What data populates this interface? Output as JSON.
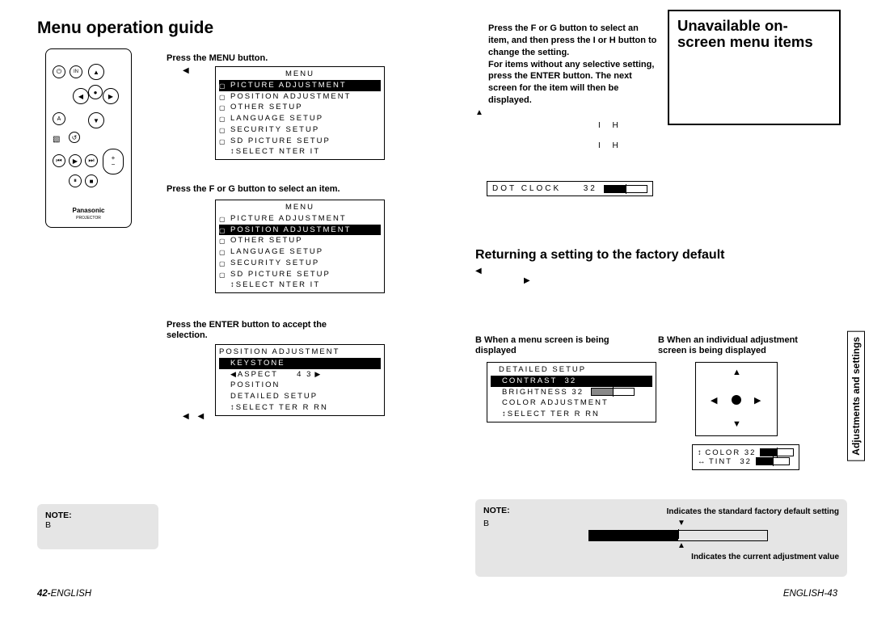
{
  "left": {
    "title": "Menu operation guide",
    "step1": "Press the MENU button.",
    "step2": "Press the F   or G   button to select an item.",
    "step3": "Press the ENTER button to accept the selection.",
    "menu1": {
      "title": "MENU",
      "items": [
        {
          "label": "PICTURE ADJUSTMENT",
          "sel": true
        },
        {
          "label": "POSITION ADJUSTMENT",
          "sel": false
        },
        {
          "label": "OTHER SETUP",
          "sel": false
        },
        {
          "label": "LANGUAGE SETUP",
          "sel": false
        },
        {
          "label": "SECURITY SETUP",
          "sel": false
        },
        {
          "label": "SD PICTURE SETUP",
          "sel": false
        }
      ],
      "footer": "SELECT    NTER    IT"
    },
    "menu2": {
      "title": "MENU",
      "items": [
        {
          "label": "PICTURE ADJUSTMENT",
          "sel": false
        },
        {
          "label": "POSITION ADJUSTMENT",
          "sel": true
        },
        {
          "label": "OTHER SETUP",
          "sel": false
        },
        {
          "label": "LANGUAGE SETUP",
          "sel": false
        },
        {
          "label": "SECURITY SETUP",
          "sel": false
        },
        {
          "label": "SD PICTURE SETUP",
          "sel": false
        }
      ],
      "footer": "SELECT    NTER    IT"
    },
    "menu3": {
      "title": "POSITION ADJUSTMENT",
      "items": [
        {
          "label": "KEYSTONE",
          "sel": true,
          "val": ""
        },
        {
          "label": "ASPECT",
          "sel": false,
          "val": "4 3"
        },
        {
          "label": "POSITION",
          "sel": false,
          "val": ""
        },
        {
          "label": "DETAILED SETUP",
          "sel": false,
          "val": ""
        }
      ],
      "footer": "SELECT    TER  R   RN"
    },
    "note": "NOTE:",
    "note_body": "B",
    "remote_brand": "Panasonic",
    "remote_sub": "PROJECTOR",
    "page_num": "42-",
    "page_lang": "ENGLISH"
  },
  "right": {
    "step4a": "Press the F   or G   button to select an item, and then press the I   or H   button to change the setting.",
    "step4b": "For items without any selective setting, press the ENTER button. The next screen for the item will then be displayed.",
    "corner_title": "Unavailable on-screen menu items",
    "corner_ih1": "I   H",
    "corner_ih2": "I   H",
    "dot_clock_label": "DOT CLOCK",
    "dot_clock_val": "32",
    "returning_title": "Returning a setting to the factory default",
    "case1": "B   When a menu screen is being displayed",
    "case2": "B   When an individual adjustment screen is being displayed",
    "menu4": {
      "title": "DETAILED SETUP",
      "items": [
        {
          "label": "CONTRAST",
          "val": "32",
          "sel": true
        },
        {
          "label": "BRIGHTNESS",
          "val": "32",
          "sel": false
        },
        {
          "label": "COLOR ADJUSTMENT",
          "val": "",
          "sel": false
        }
      ],
      "footer": "SELECT    TER  R   RN"
    },
    "adj_rows": [
      {
        "label": "COLOR",
        "val": "32"
      },
      {
        "label": "TINT",
        "val": "32"
      }
    ],
    "note": "NOTE:",
    "note_body": "B",
    "note_r1": "Indicates the standard factory default setting",
    "note_r2": "Indicates the current adjustment value",
    "side_tab": "Adjustments and settings",
    "page_lang": "ENGLISH",
    "page_num": "-43"
  }
}
